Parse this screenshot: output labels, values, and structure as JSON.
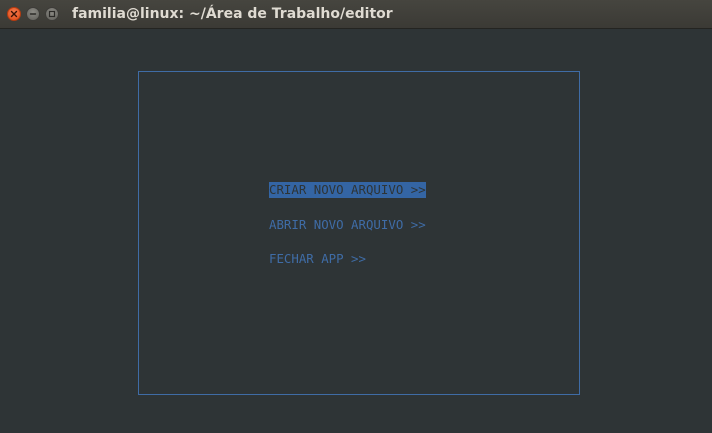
{
  "window": {
    "title": "familia@linux: ~/Área de Trabalho/editor",
    "controls": {
      "close_icon": "close-icon",
      "minimize_icon": "minimize-icon",
      "maximize_icon": "maximize-icon"
    }
  },
  "menu": {
    "items": [
      {
        "label": "CRIAR NOVO ARQUIVO >>",
        "selected": true
      },
      {
        "label": "ABRIR NOVO ARQUIVO >>",
        "selected": false
      },
      {
        "label": "FECHAR APP >>",
        "selected": false
      }
    ]
  },
  "colors": {
    "terminal_background": "#2e3436",
    "accent_blue": "#3465a4",
    "close_button": "#df4a16"
  }
}
